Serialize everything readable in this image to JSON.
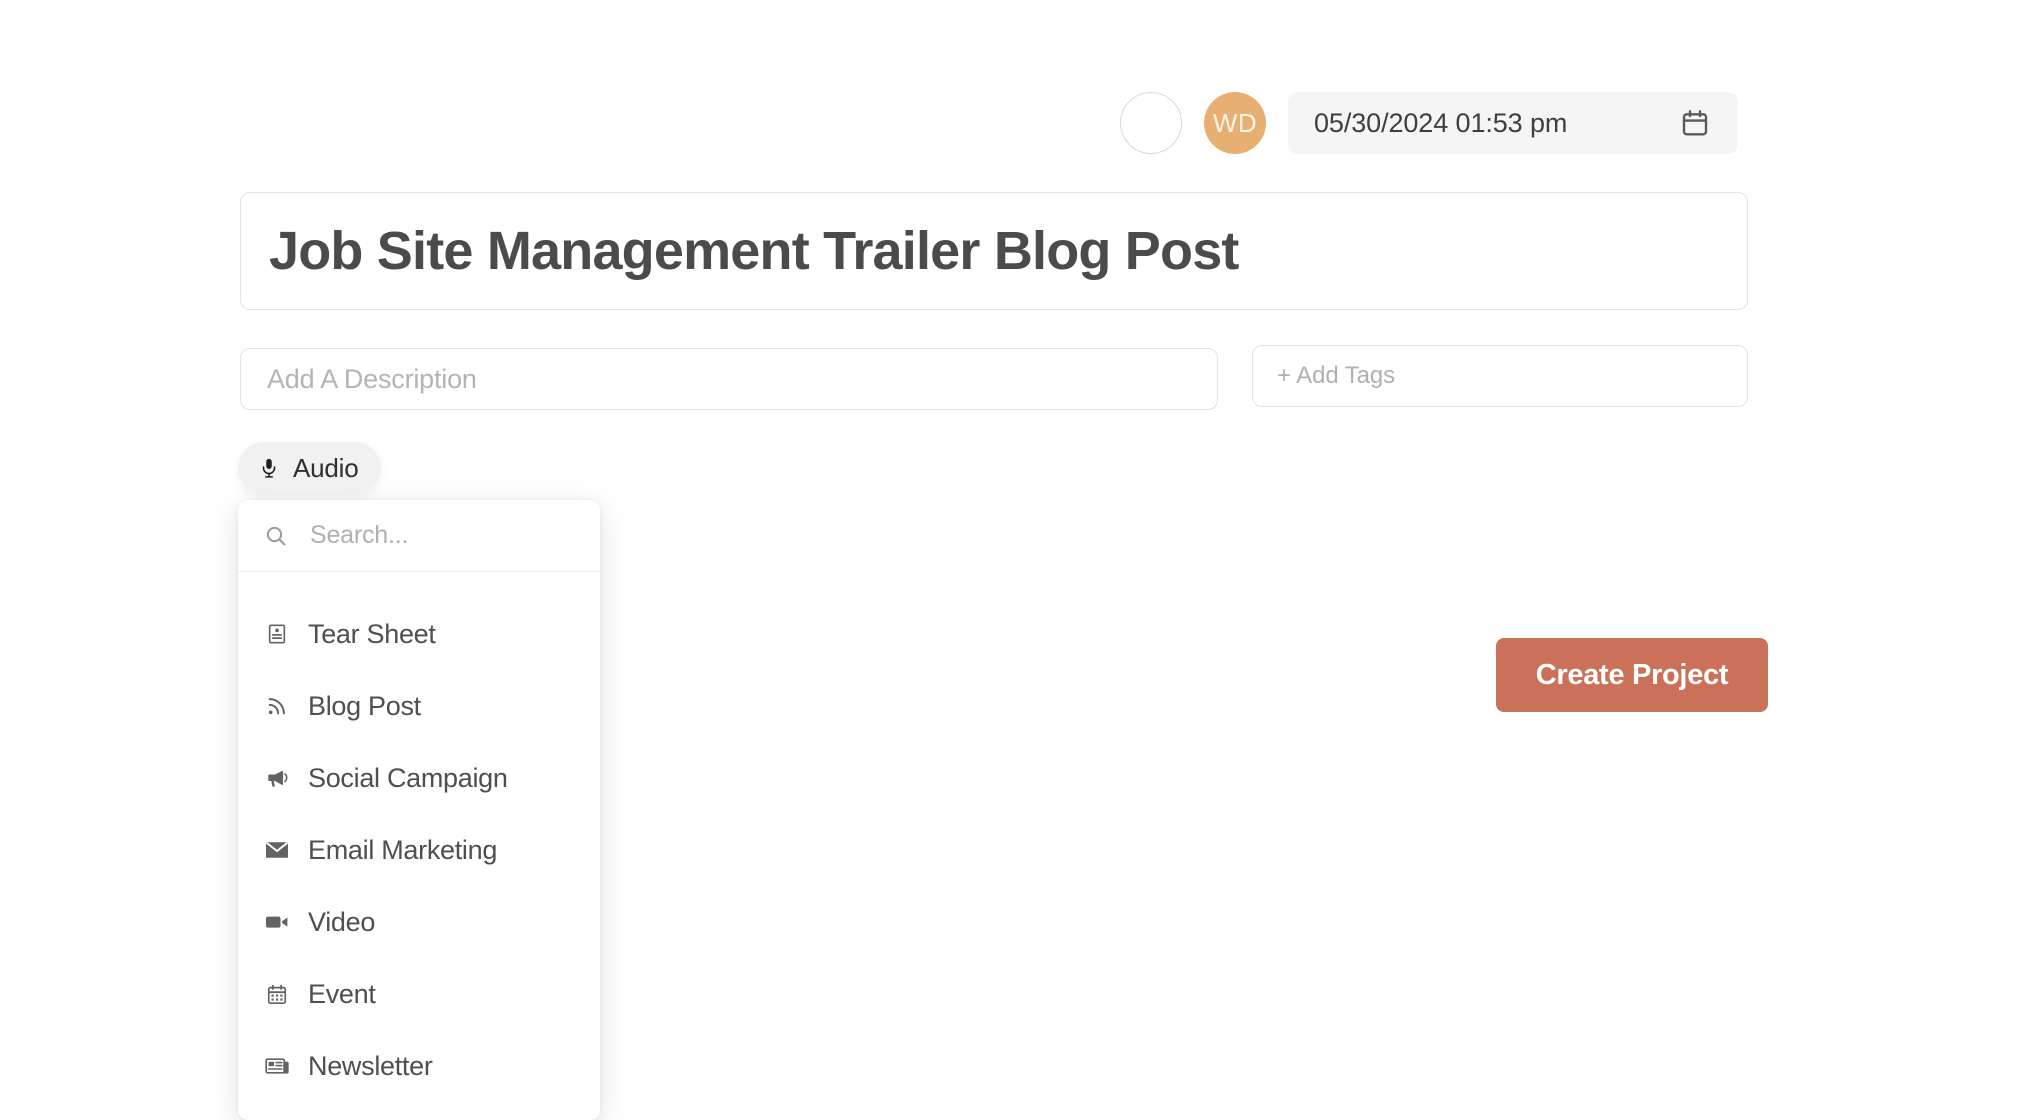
{
  "topbar": {
    "avatar_placeholder_name": "unassigned-user",
    "avatar_initials": "WD",
    "date_value": "05/30/2024 01:53 pm",
    "calendar_icon": "calendar-icon"
  },
  "project": {
    "title": "Job Site Management Trailer Blog Post",
    "description_placeholder": "Add A Description",
    "tags_placeholder": "+ Add Tags"
  },
  "type_selector": {
    "selected_label": "Audio",
    "selected_icon": "microphone-icon",
    "search_placeholder": "Search...",
    "search_value": "",
    "search_icon": "search-icon",
    "options": [
      {
        "label": "Tear Sheet",
        "icon": "tear-sheet-icon"
      },
      {
        "label": "Blog Post",
        "icon": "rss-icon"
      },
      {
        "label": "Social Campaign",
        "icon": "bullhorn-icon"
      },
      {
        "label": "Email Marketing",
        "icon": "envelope-icon"
      },
      {
        "label": "Video",
        "icon": "video-camera-icon"
      },
      {
        "label": "Event",
        "icon": "calendar-alt-icon"
      },
      {
        "label": "Newsletter",
        "icon": "newspaper-icon"
      }
    ]
  },
  "actions": {
    "create_label": "Create Project"
  },
  "colors": {
    "accent": "#cc7159",
    "avatar": "#e7b072",
    "field_bg": "#f5f5f5",
    "title_text": "#4b4b4b",
    "placeholder": "#b4b4b4"
  }
}
